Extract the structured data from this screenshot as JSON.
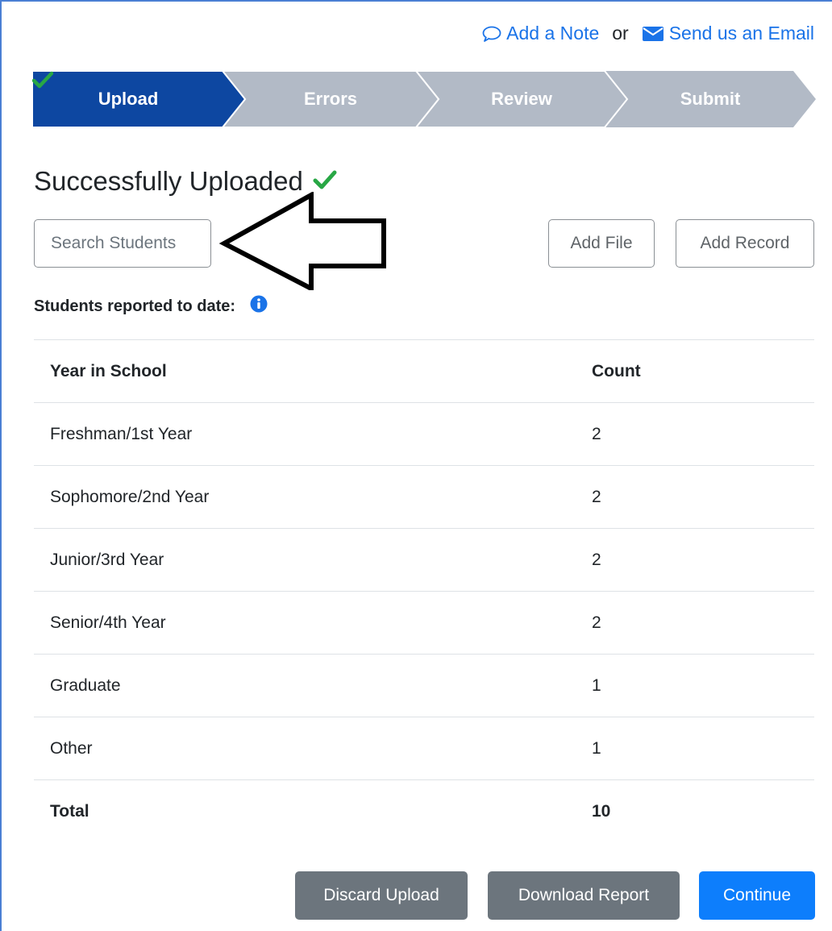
{
  "top_links": {
    "add_note": "Add a Note",
    "or": "or",
    "send_email": "Send us an Email"
  },
  "stepper": {
    "steps": [
      {
        "label": "Upload",
        "state": "complete"
      },
      {
        "label": "Errors",
        "state": "pending"
      },
      {
        "label": "Review",
        "state": "pending"
      },
      {
        "label": "Submit",
        "state": "pending"
      }
    ],
    "active_color": "#0d47a1",
    "inactive_color": "#b2bac6",
    "check_color": "#28a745"
  },
  "page_title": "Successfully Uploaded",
  "search": {
    "placeholder": "Search Students"
  },
  "buttons": {
    "add_file": "Add File",
    "add_record": "Add Record",
    "discard": "Discard Upload",
    "download": "Download Report",
    "continue": "Continue"
  },
  "reported_label": "Students reported to date:",
  "table": {
    "headers": [
      "Year in School",
      "Count"
    ],
    "rows": [
      [
        "Freshman/1st Year",
        "2"
      ],
      [
        "Sophomore/2nd Year",
        "2"
      ],
      [
        "Junior/3rd Year",
        "2"
      ],
      [
        "Senior/4th Year",
        "2"
      ],
      [
        "Graduate",
        "1"
      ],
      [
        "Other",
        "1"
      ]
    ],
    "total": [
      "Total",
      "10"
    ]
  },
  "icons": {
    "note": "speech-bubble-icon",
    "email": "envelope-icon",
    "check": "checkmark-icon",
    "info": "info-circle-icon",
    "annotation": "left-arrow-annotation"
  }
}
